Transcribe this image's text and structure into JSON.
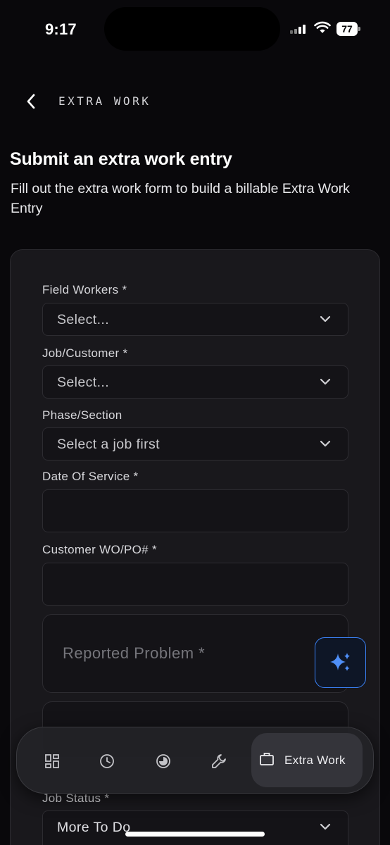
{
  "status_bar": {
    "time": "9:17",
    "battery": "77"
  },
  "header": {
    "title": "EXTRA WORK"
  },
  "page": {
    "title": "Submit an extra work entry",
    "subtitle": "Fill out the extra work form to build a billable Extra Work Entry"
  },
  "form": {
    "field_workers": {
      "label": "Field Workers *",
      "value": "Select..."
    },
    "job_customer": {
      "label": "Job/Customer *",
      "value": "Select..."
    },
    "phase_section": {
      "label": "Phase/Section",
      "value": "Select a job first"
    },
    "date_of_service": {
      "label": "Date Of Service *",
      "value": ""
    },
    "customer_wo_po": {
      "label": "Customer WO/PO# *",
      "value": ""
    },
    "reported_problem": {
      "placeholder": "Reported Problem *"
    },
    "job_status": {
      "label": "Job Status *",
      "value": "More To Do"
    }
  },
  "nav": {
    "items": [
      {
        "icon": "dashboard-icon"
      },
      {
        "icon": "clock-icon"
      },
      {
        "icon": "pie-chart-icon"
      },
      {
        "icon": "wrench-icon"
      }
    ],
    "active_label": "Extra Work",
    "active_icon": "briefcase-icon"
  },
  "colors": {
    "background": "#09080b",
    "card": "#19181c",
    "accent": "#3b82f6"
  }
}
